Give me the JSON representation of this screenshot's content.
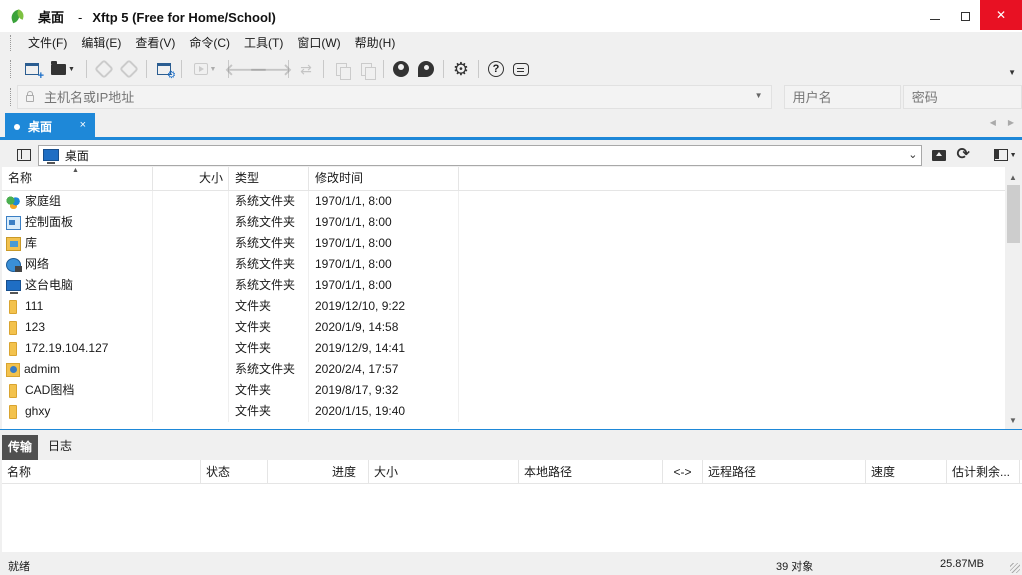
{
  "window": {
    "title_location": "桌面",
    "title_separator": "-",
    "title_app": "Xftp 5 (Free for Home/School)"
  },
  "menu": [
    "文件(F)",
    "编辑(E)",
    "查看(V)",
    "命令(C)",
    "工具(T)",
    "窗口(W)",
    "帮助(H)"
  ],
  "address": {
    "host_placeholder": "主机名或IP地址",
    "user_placeholder": "用户名",
    "password_placeholder": "密码"
  },
  "tabs": [
    {
      "label": "桌面",
      "close": "×",
      "active": true
    }
  ],
  "path": {
    "current": "桌面"
  },
  "file_list": {
    "columns": {
      "name": "名称",
      "size": "大小",
      "type": "类型",
      "modified": "修改时间"
    },
    "rows": [
      {
        "icon": "homegroup-icon",
        "name": "家庭组",
        "size": "",
        "type": "系统文件夹",
        "modified": "1970/1/1, 8:00"
      },
      {
        "icon": "control-panel-icon",
        "name": "控制面板",
        "size": "",
        "type": "系统文件夹",
        "modified": "1970/1/1, 8:00"
      },
      {
        "icon": "library-icon",
        "name": "库",
        "size": "",
        "type": "系统文件夹",
        "modified": "1970/1/1, 8:00"
      },
      {
        "icon": "network-icon",
        "name": "网络",
        "size": "",
        "type": "系统文件夹",
        "modified": "1970/1/1, 8:00"
      },
      {
        "icon": "this-pc-icon",
        "name": "这台电脑",
        "size": "",
        "type": "系统文件夹",
        "modified": "1970/1/1, 8:00"
      },
      {
        "icon": "folder-icon",
        "name": "111",
        "size": "",
        "type": "文件夹",
        "modified": "2019/12/10, 9:22"
      },
      {
        "icon": "folder-icon",
        "name": "123",
        "size": "",
        "type": "文件夹",
        "modified": "2020/1/9, 14:58"
      },
      {
        "icon": "folder-icon",
        "name": "172.19.104.127",
        "size": "",
        "type": "文件夹",
        "modified": "2019/12/9, 14:41"
      },
      {
        "icon": "user-folder-icon",
        "name": "admim",
        "size": "",
        "type": "系统文件夹",
        "modified": "2020/2/4, 17:57"
      },
      {
        "icon": "folder-icon",
        "name": "CAD图档",
        "size": "",
        "type": "文件夹",
        "modified": "2019/8/17, 9:32"
      },
      {
        "icon": "folder-icon",
        "name": "ghxy",
        "size": "",
        "type": "文件夹",
        "modified": "2020/1/15, 19:40"
      }
    ]
  },
  "transfer": {
    "tabs": [
      "传输",
      "日志"
    ],
    "columns": [
      "名称",
      "状态",
      "进度",
      "大小",
      "本地路径",
      "<->",
      "远程路径",
      "速度",
      "估计剩余..."
    ]
  },
  "status": {
    "text": "就绪",
    "count": "39 对象",
    "size": "25.87MB"
  },
  "colors": {
    "accent": "#1e88d8",
    "close_button": "#e81123",
    "active_transfer_tab": "#505050"
  }
}
